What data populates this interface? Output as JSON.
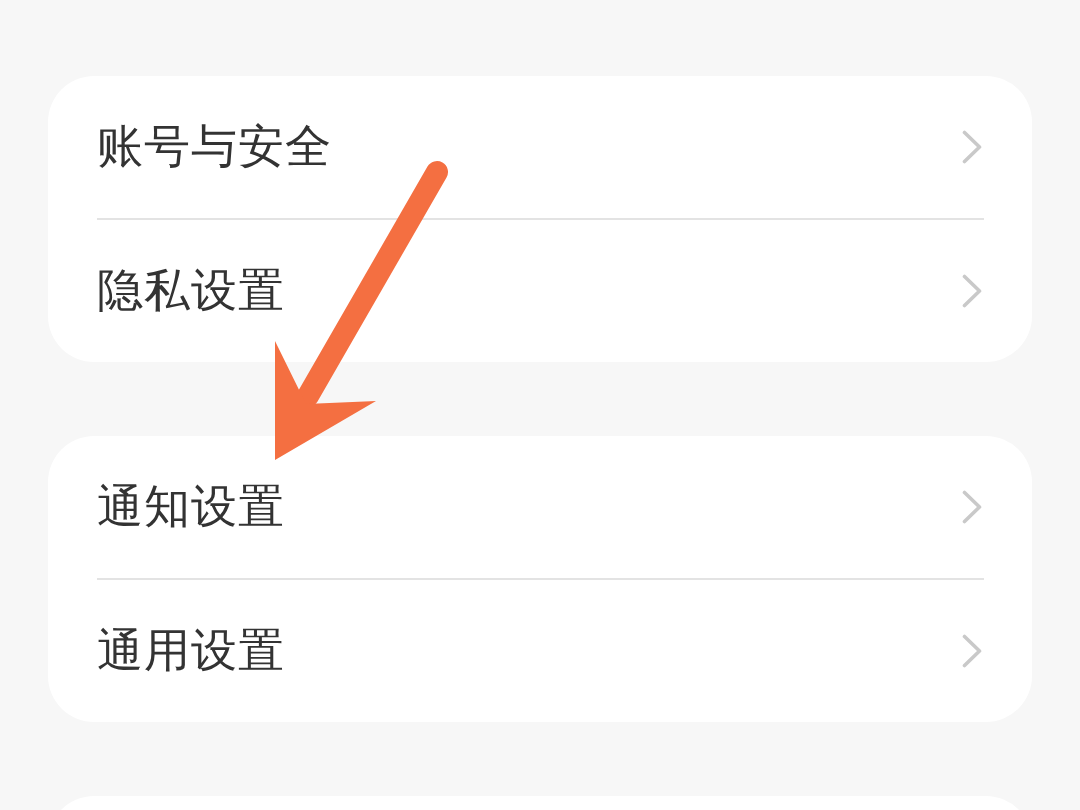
{
  "groups": [
    {
      "items": [
        {
          "label": "账号与安全"
        },
        {
          "label": "隐私设置"
        }
      ]
    },
    {
      "items": [
        {
          "label": "通知设置"
        },
        {
          "label": "通用设置"
        }
      ]
    }
  ],
  "annotation": {
    "kind": "arrow"
  }
}
